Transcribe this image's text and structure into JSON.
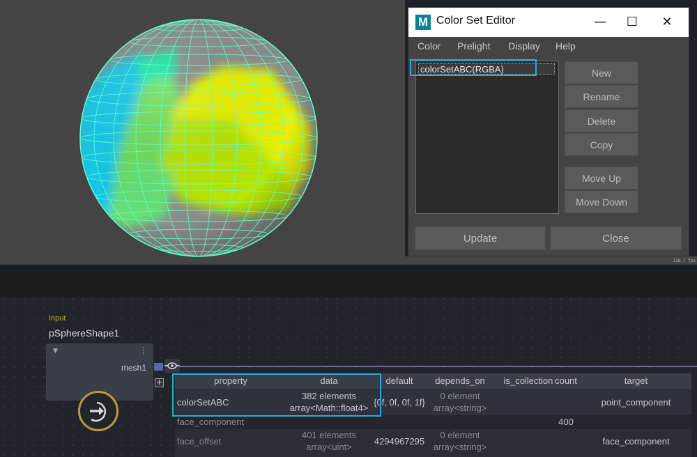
{
  "viewport": {
    "readout": "118.7 fps"
  },
  "color_set_editor": {
    "title": "Color Set Editor",
    "logo": "M",
    "window_controls": {
      "minimize": "—",
      "maximize": "☐",
      "close": "✕"
    },
    "menu": [
      "Color",
      "Prelight",
      "Display",
      "Help"
    ],
    "list_items": [
      "colorSetABC(RGBA)"
    ],
    "side_buttons": [
      "New",
      "Rename",
      "Delete",
      "Copy",
      "Move Up",
      "Move Down"
    ],
    "bottom_buttons": [
      "Update",
      "Close"
    ]
  },
  "node": {
    "input_label": "Input",
    "name": "pSphereShape1",
    "port_label": "mesh1",
    "plus": "+",
    "menu_dots": "⋮",
    "collapse": "▼"
  },
  "table": {
    "headers": [
      "property",
      "data",
      "default",
      "depends_on",
      "is_collection",
      "count",
      "target"
    ],
    "rows": [
      {
        "property": "colorSetABC",
        "data": [
          "382 elements",
          "array<Math::float4>"
        ],
        "default": "{0f, 0f, 0f, 1f}",
        "depends_on": [
          "0 element",
          "array<string>"
        ],
        "is_collection": "",
        "count": "",
        "target": "point_component"
      },
      {
        "property": "face_component",
        "data": [
          "",
          ""
        ],
        "default": "",
        "depends_on": [
          "",
          ""
        ],
        "is_collection": "",
        "count": "400",
        "target": ""
      },
      {
        "property": "face_offset",
        "data": [
          "401 elements",
          "array<uint>"
        ],
        "default": "4294967295",
        "depends_on": [
          "0 element",
          "array<string>"
        ],
        "is_collection": "",
        "count": "",
        "target": "face_component"
      }
    ]
  },
  "colors": {
    "accent_highlight": "#29a8e0",
    "wire": "#5effc8",
    "node_gold": "#b79a3e",
    "port_blue": "#5a66a8"
  },
  "icons": [
    "maya-logo-icon",
    "eye-icon",
    "arrow-right-circle-icon",
    "plus-icon",
    "kebab-menu-icon",
    "collapse-triangle-icon"
  ]
}
